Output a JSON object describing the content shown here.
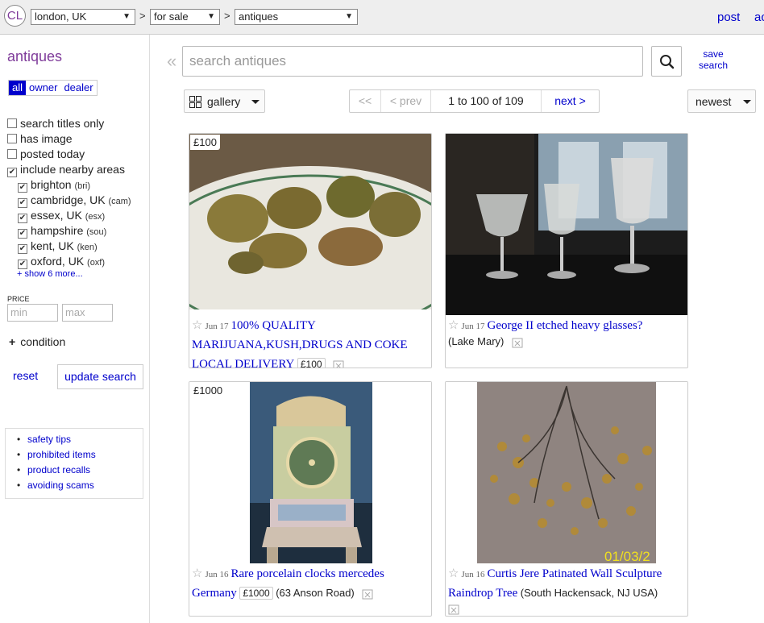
{
  "topbar": {
    "logo": "CL",
    "location": "london, UK",
    "category_group": "for sale",
    "category": "antiques",
    "sep": ">",
    "post": "post",
    "account": "ac"
  },
  "sidebar": {
    "title": "antiques",
    "seller_tabs": [
      "all",
      "owner",
      "dealer"
    ],
    "filters": [
      {
        "label": "search titles only",
        "checked": false
      },
      {
        "label": "has image",
        "checked": false
      },
      {
        "label": "posted today",
        "checked": false
      },
      {
        "label": "include nearby areas",
        "checked": true
      }
    ],
    "nearby": [
      {
        "label": "brighton",
        "abbr": "(bri)"
      },
      {
        "label": "cambridge, UK",
        "abbr": "(cam)"
      },
      {
        "label": "essex, UK",
        "abbr": "(esx)"
      },
      {
        "label": "hampshire",
        "abbr": "(sou)"
      },
      {
        "label": "kent, UK",
        "abbr": "(ken)"
      },
      {
        "label": "oxford, UK",
        "abbr": "(oxf)"
      }
    ],
    "show_more": "+ show 6 more...",
    "price_label": "PRICE",
    "price_min_placeholder": "min",
    "price_max_placeholder": "max",
    "condition_plus": "+",
    "condition": "condition",
    "reset": "reset",
    "update_search": "update search",
    "help_links": [
      "safety tips",
      "prohibited items",
      "product recalls",
      "avoiding scams"
    ]
  },
  "search": {
    "collapse": "«",
    "placeholder": "search antiques",
    "save_line1": "save",
    "save_line2": "search"
  },
  "toolbar": {
    "view": "gallery",
    "pager_first": "<<",
    "pager_prev": "< prev",
    "pager_range": "1 to 100 of 109",
    "pager_next": "next >",
    "sort": "newest"
  },
  "listings": [
    {
      "price": "£100",
      "star": "☆",
      "date": "Jun 17",
      "title": "100% QUALITY MARIJUANA,KUSH,DRUGS AND COKE LOCAL DELIVERY",
      "title_line1": "100% QUALITY",
      "title_line2": "MARIJUANA,KUSH,DRUGS AND COKE",
      "title_line3": "LOCAL DELIVERY",
      "price_inline": "£100",
      "hood": ""
    },
    {
      "price": "",
      "star": "☆",
      "date": "Jun 17",
      "title": "George II etched heavy glasses?",
      "price_inline": "",
      "hood": "(Lake Mary)"
    },
    {
      "price": "£1000",
      "star": "☆",
      "date": "Jun 16",
      "title_line1": "Rare porcelain clocks mercedes",
      "title_line2": "Germany",
      "price_inline": "£1000",
      "hood": "(63 Anson Road)"
    },
    {
      "price": "",
      "star": "☆",
      "date": "Jun 16",
      "title_line1": "Curtis Jere Patinated Wall Sculpture",
      "title_line2": "Raindrop Tree",
      "price_inline": "",
      "hood": "(South Hackensack, NJ USA)",
      "photo_stamp": "01/03/2"
    }
  ],
  "colors": {
    "accent_purple": "#7f3b9a",
    "link_blue": "#0000cc",
    "topbar_bg": "#eeeeee"
  }
}
